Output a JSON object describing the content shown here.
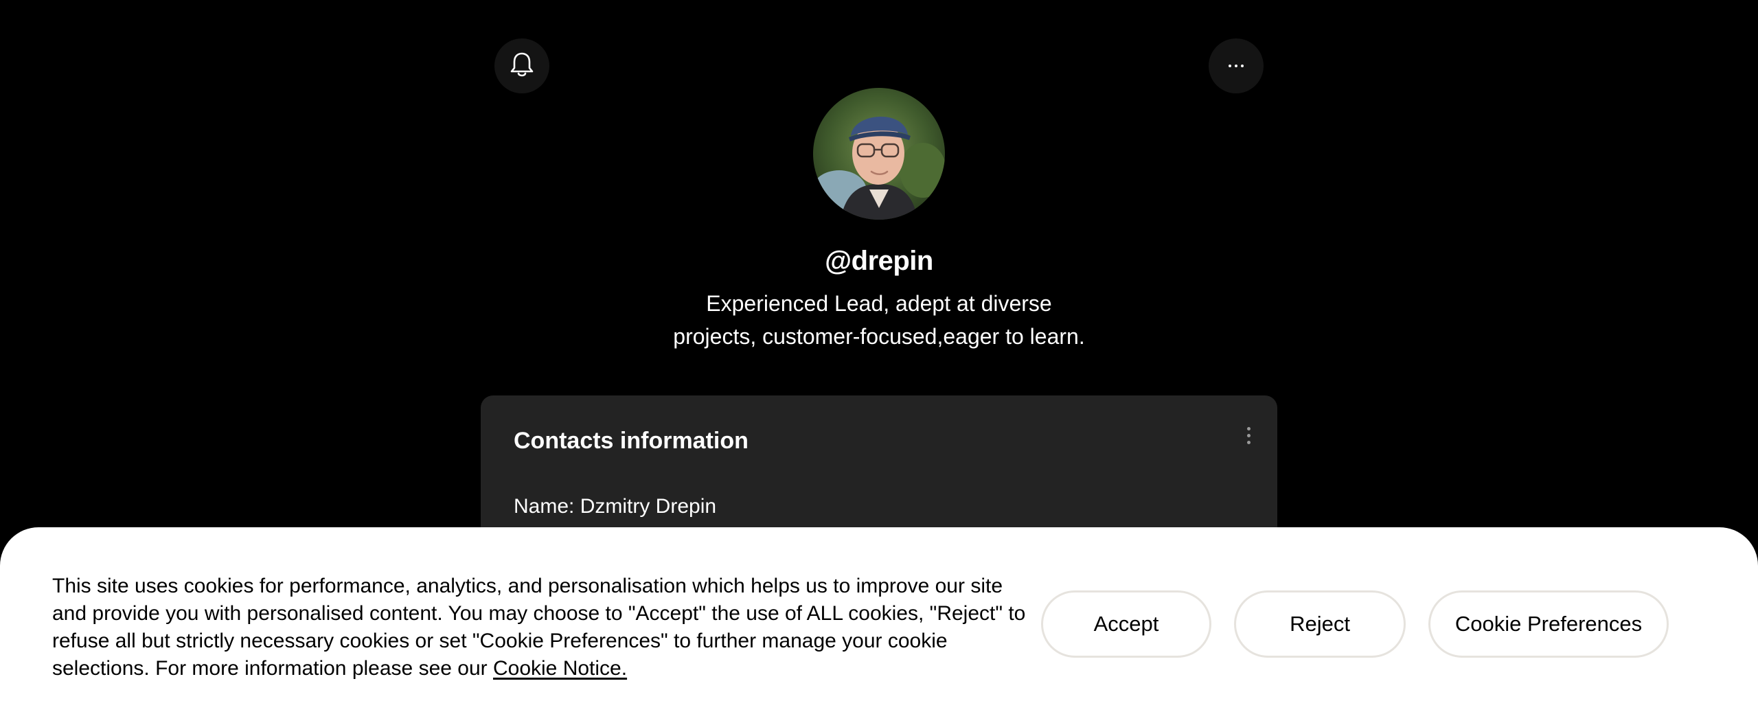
{
  "header": {
    "notifications_icon": "bell-icon",
    "more_icon": "more-horizontal-icon"
  },
  "profile": {
    "username": "@drepin",
    "bio_line_1": "Experienced Lead, adept at diverse",
    "bio_line_2": "projects, customer-focused,eager to learn."
  },
  "contacts_card": {
    "title": "Contacts information",
    "menu_icon": "more-vertical-icon",
    "name_row": "Name: Dzmitry Drepin"
  },
  "cookie_banner": {
    "text": "This site uses cookies for performance, analytics, and personalisation which helps us to improve our site and provide you with personalised content. You may choose to \"Accept\" the use of ALL cookies, \"Reject\" to refuse all but strictly necessary cookies or set \"Cookie Preferences\" to further manage your cookie selections. For more information please see our",
    "link_text": "Cookie Notice.",
    "accept_label": "Accept",
    "reject_label": "Reject",
    "preferences_label": "Cookie Preferences"
  },
  "colors": {
    "page_background": "#000000",
    "card_background": "#232323",
    "icon_button_background": "#141414",
    "banner_background": "#ffffff",
    "button_border": "#e6e3de"
  }
}
